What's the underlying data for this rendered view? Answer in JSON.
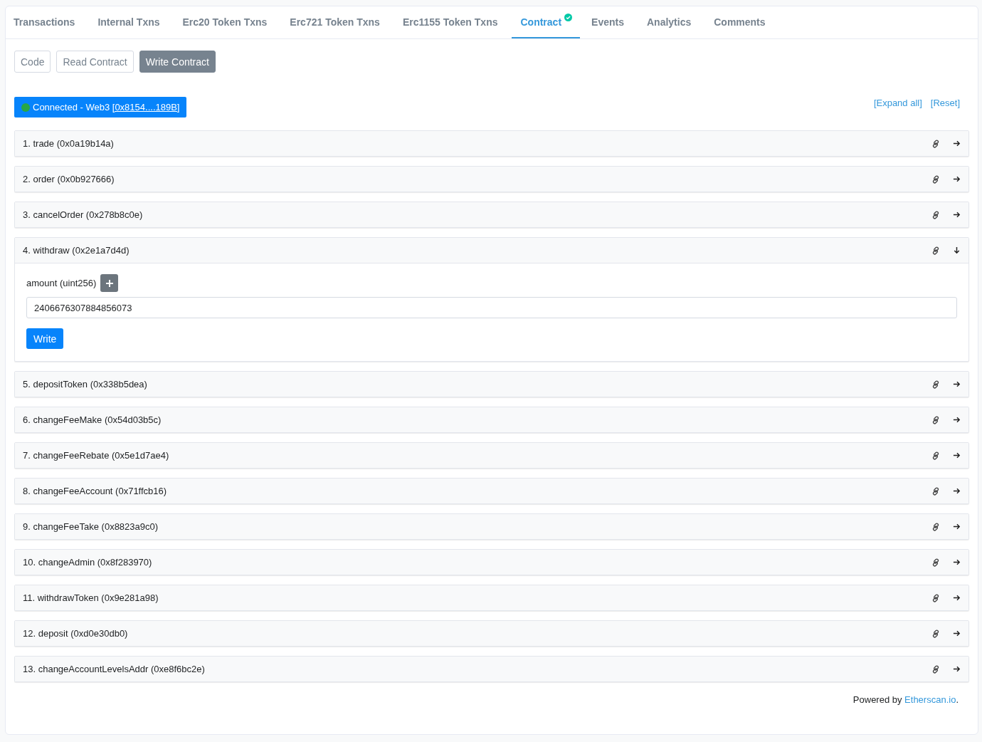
{
  "tabs": [
    {
      "label": "Transactions",
      "selected": false,
      "verified": false
    },
    {
      "label": "Internal Txns",
      "selected": false,
      "verified": false
    },
    {
      "label": "Erc20 Token Txns",
      "selected": false,
      "verified": false
    },
    {
      "label": "Erc721 Token Txns",
      "selected": false,
      "verified": false
    },
    {
      "label": "Erc1155 Token Txns",
      "selected": false,
      "verified": false
    },
    {
      "label": "Contract",
      "selected": true,
      "verified": true
    },
    {
      "label": "Events",
      "selected": false,
      "verified": false
    },
    {
      "label": "Analytics",
      "selected": false,
      "verified": false
    },
    {
      "label": "Comments",
      "selected": false,
      "verified": false
    }
  ],
  "subtabs": [
    {
      "label": "Code",
      "selected": false
    },
    {
      "label": "Read Contract",
      "selected": false
    },
    {
      "label": "Write Contract",
      "selected": true
    }
  ],
  "connect_button": {
    "label": "Connected - Web3 ",
    "address": "[0x8154....189B]"
  },
  "expand_all": "[Expand all]",
  "reset": "[Reset]",
  "functions": [
    {
      "title": "1. trade (0x0a19b14a)",
      "expanded": false
    },
    {
      "title": "2. order (0x0b927666)",
      "expanded": false
    },
    {
      "title": "3. cancelOrder (0x278b8c0e)",
      "expanded": false
    },
    {
      "title": "4. withdraw (0x2e1a7d4d)",
      "expanded": true,
      "inputs": [
        {
          "label": "amount (uint256)",
          "value": "2406676307884856073"
        }
      ],
      "button": "Write"
    },
    {
      "title": "5. depositToken (0x338b5dea)",
      "expanded": false
    },
    {
      "title": "6. changeFeeMake (0x54d03b5c)",
      "expanded": false
    },
    {
      "title": "7. changeFeeRebate (0x5e1d7ae4)",
      "expanded": false
    },
    {
      "title": "8. changeFeeAccount (0x71ffcb16)",
      "expanded": false
    },
    {
      "title": "9. changeFeeTake (0x8823a9c0)",
      "expanded": false
    },
    {
      "title": "10. changeAdmin (0x8f283970)",
      "expanded": false
    },
    {
      "title": "11. withdrawToken (0x9e281a98)",
      "expanded": false
    },
    {
      "title": "12. deposit (0xd0e30db0)",
      "expanded": false
    },
    {
      "title": "13. changeAccountLevelsAddr (0xe8f6bc2e)",
      "expanded": false
    }
  ],
  "footer": {
    "prefix": "Powered by ",
    "link": "Etherscan.io",
    "suffix": "."
  }
}
